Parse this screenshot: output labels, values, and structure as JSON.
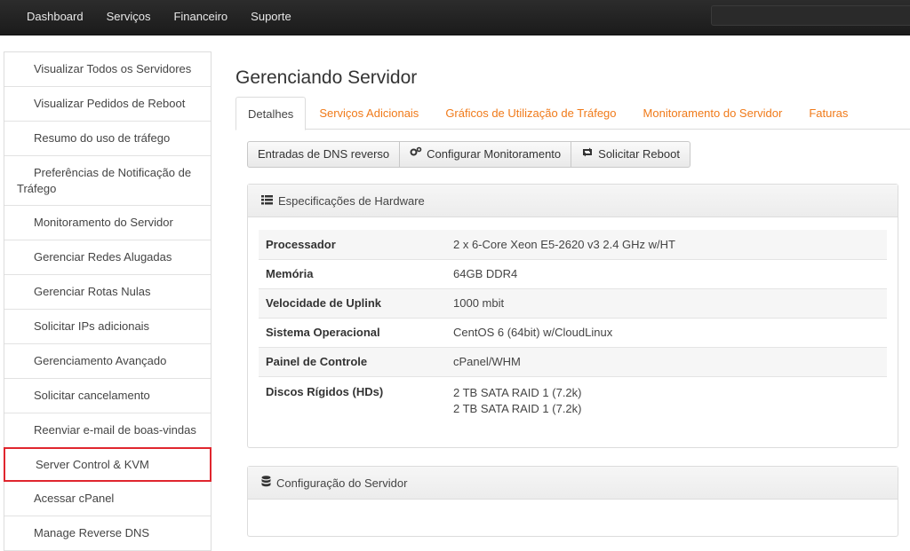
{
  "topnav": [
    "Dashboard",
    "Serviços",
    "Financeiro",
    "Suporte"
  ],
  "sidebar": {
    "items": [
      "Visualizar Todos os Servidores",
      "Visualizar Pedidos de Reboot",
      "Resumo do uso de tráfego",
      "Preferências de Notificação de Tráfego",
      "Monitoramento do Servidor",
      "Gerenciar Redes Alugadas",
      "Gerenciar Rotas Nulas",
      "Solicitar IPs adicionais",
      "Gerenciamento Avançado",
      "Solicitar cancelamento",
      "Reenviar e-mail de boas-vindas",
      "Server Control & KVM",
      "Acessar cPanel",
      "Manage Reverse DNS"
    ],
    "highlighted_index": 11
  },
  "page_title": "Gerenciando Servidor",
  "tabs": [
    "Detalhes",
    "Serviços Adicionais",
    "Gráficos de Utilização de Tráfego",
    "Monitoramento do Servidor",
    "Faturas"
  ],
  "active_tab": "Detalhes",
  "buttons": {
    "rdns": "Entradas de DNS reverso",
    "monitor": "Configurar Monitoramento",
    "reboot": "Solicitar Reboot"
  },
  "hardware_panel": {
    "title": "Especificações de Hardware",
    "rows": [
      {
        "label": "Processador",
        "value": "2 x 6-Core Xeon E5-2620 v3 2.4 GHz w/HT"
      },
      {
        "label": "Memória",
        "value": "64GB DDR4"
      },
      {
        "label": "Velocidade de Uplink",
        "value": "1000 mbit"
      },
      {
        "label": "Sistema Operacional",
        "value": "CentOS 6 (64bit) w/CloudLinux"
      },
      {
        "label": "Painel de Controle",
        "value": "cPanel/WHM"
      },
      {
        "label": "Discos Rígidos (HDs)",
        "value_lines": [
          "2 TB SATA RAID 1 (7.2k)",
          "2 TB SATA RAID 1 (7.2k)"
        ]
      }
    ]
  },
  "config_panel": {
    "title": "Configuração do Servidor"
  },
  "colors": {
    "topbar": "#1f1f1f",
    "tab_link": "#f07a19",
    "highlight_border": "#e0262e"
  }
}
